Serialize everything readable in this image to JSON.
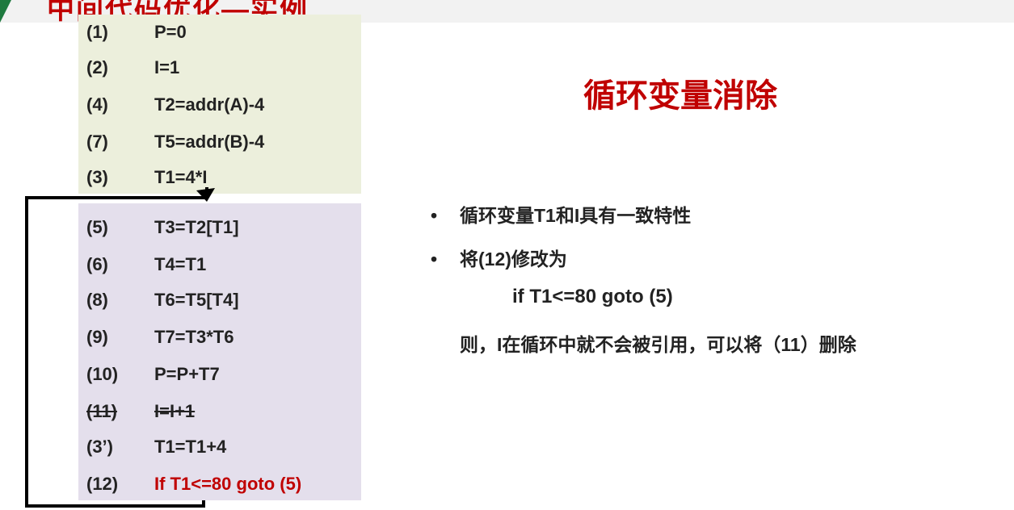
{
  "slide": {
    "title_fragment": "中间代码优化—实例"
  },
  "code": {
    "preheader": [
      {
        "num": "(1)",
        "stmt": "P=0"
      },
      {
        "num": "(2)",
        "stmt": "I=1"
      },
      {
        "num": "(4)",
        "stmt": "T2=addr(A)-4"
      },
      {
        "num": "(7)",
        "stmt": "T5=addr(B)-4"
      },
      {
        "num": "(3)",
        "stmt": "T1=4*I"
      }
    ],
    "loop": [
      {
        "num": "(5)",
        "stmt": "T3=T2[T1]"
      },
      {
        "num": "(6)",
        "stmt": "T4=T1"
      },
      {
        "num": "(8)",
        "stmt": "T6=T5[T4]"
      },
      {
        "num": "(9)",
        "stmt": "T7=T3*T6"
      },
      {
        "num": "(10)",
        "stmt": "P=P+T7"
      },
      {
        "num": "(11)",
        "stmt": "I=I+1"
      },
      {
        "num": "(3’)",
        "stmt": "T1=T1+4"
      },
      {
        "num": "(12)",
        "stmt": "If T1<=80 goto (5)"
      }
    ]
  },
  "explanation": {
    "heading": "循环变量消除",
    "bullets": [
      "循环变量T1和I具有一致特性",
      "将(12)修改为"
    ],
    "bullet_marker": "•",
    "code_line": "if T1<=80 goto (5)",
    "conclusion": "则，I在循环中就不会被引用，可以将（11）删除"
  },
  "colors": {
    "accent_red": "#c00000",
    "preheader_bg": "#ecefdc",
    "loop_bg": "#e4dfec",
    "corner_green": "#1f7a3f"
  }
}
